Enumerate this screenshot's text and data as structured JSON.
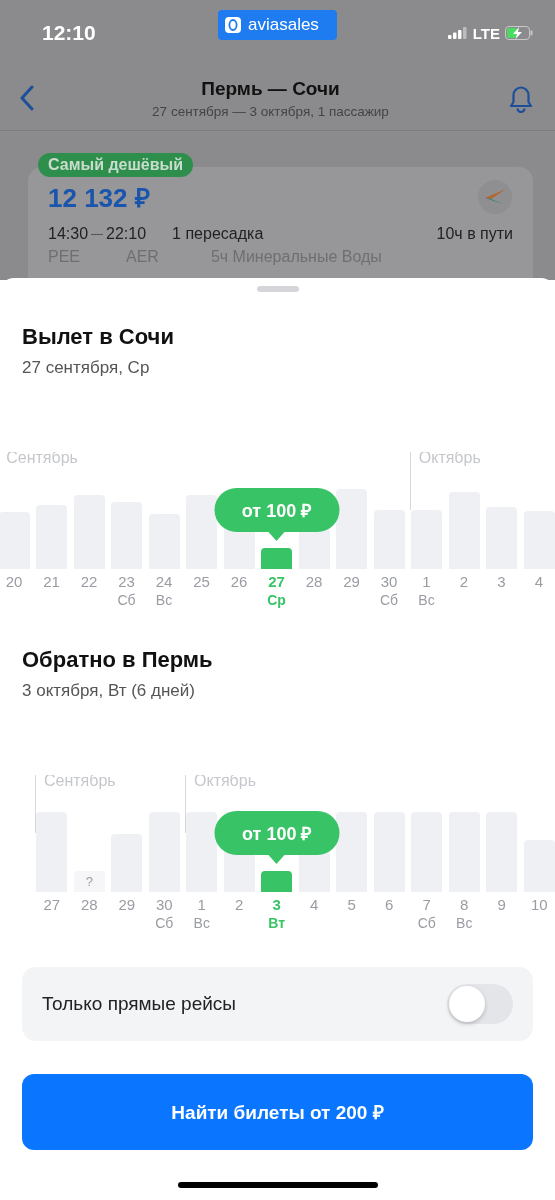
{
  "status_bar": {
    "time": "12:10",
    "app_badge": "aviasales",
    "network": "LTE"
  },
  "header": {
    "title": "Пермь — Сочи",
    "subtitle": "27 сентября — 3 октября, 1 пассажир"
  },
  "ticket": {
    "badge": "Самый дешёвый",
    "price": "12 132 ₽",
    "depart_time": "14:30",
    "arrive_time": "22:10",
    "depart_code": "PEE",
    "arrive_code": "AER",
    "stops": "1 пересадка",
    "stopover": "5ч Минеральные Воды",
    "duration": "10ч в пути"
  },
  "calendars": [
    {
      "title": "Вылет в Сочи",
      "date": "27 сентября, Ср",
      "tooltip": "от 100 ₽",
      "days": [
        {
          "day": "20",
          "selected": false,
          "month": "Сентябрь"
        },
        {
          "day": "21",
          "selected": false
        },
        {
          "day": "22",
          "selected": false
        },
        {
          "day": "23",
          "weekday": "Сб",
          "selected": false
        },
        {
          "day": "24",
          "weekday": "Вс",
          "selected": false
        },
        {
          "day": "25",
          "selected": false
        },
        {
          "day": "26",
          "selected": false
        },
        {
          "day": "27",
          "weekday": "Ср",
          "selected": true
        },
        {
          "day": "28",
          "selected": false
        },
        {
          "day": "29",
          "selected": false
        },
        {
          "day": "30",
          "weekday": "Сб",
          "selected": false
        },
        {
          "day": "1",
          "weekday": "Вс",
          "selected": false,
          "month": "Октябрь"
        },
        {
          "day": "2",
          "selected": false
        },
        {
          "day": "3",
          "selected": false
        },
        {
          "day": "4",
          "selected": false
        }
      ]
    },
    {
      "title": "Обратно в Пермь",
      "date": "3 октября, Вт (6 дней)",
      "tooltip": "от 100 ₽",
      "days": [
        {
          "day": "27",
          "selected": false,
          "month": "Сентябрь"
        },
        {
          "day": "28",
          "kind": "unknown",
          "mark": "?",
          "selected": false
        },
        {
          "day": "29",
          "selected": false
        },
        {
          "day": "30",
          "weekday": "Сб",
          "selected": false
        },
        {
          "day": "1",
          "weekday": "Вс",
          "selected": false,
          "month": "Октябрь"
        },
        {
          "day": "2",
          "selected": false
        },
        {
          "day": "3",
          "weekday": "Вт",
          "selected": true
        },
        {
          "day": "4",
          "selected": false
        },
        {
          "day": "5",
          "selected": false
        },
        {
          "day": "6",
          "selected": false
        },
        {
          "day": "7",
          "weekday": "Сб",
          "selected": false
        },
        {
          "day": "8",
          "weekday": "Вс",
          "selected": false
        },
        {
          "day": "9",
          "selected": false
        },
        {
          "day": "10",
          "selected": false
        }
      ]
    }
  ],
  "direct_only": {
    "label": "Только прямые рейсы",
    "on": false
  },
  "search_button": "Найти билеты от 200 ₽"
}
